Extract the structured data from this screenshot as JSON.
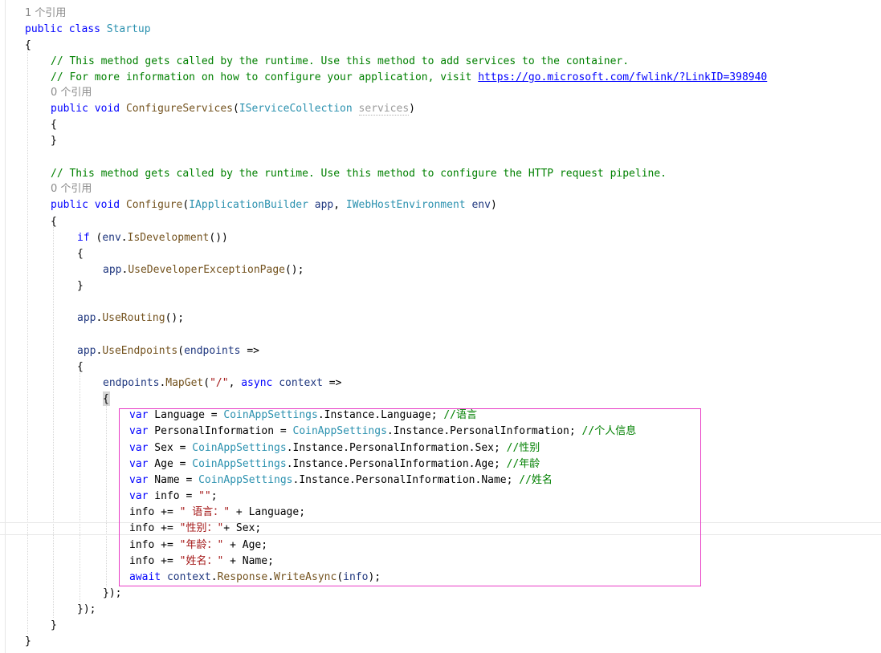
{
  "editor": {
    "lines": [
      [
        {
          "t": "1 个引用",
          "c": "lens"
        }
      ],
      [
        {
          "t": "public",
          "c": "kw"
        },
        {
          "t": " "
        },
        {
          "t": "class",
          "c": "kw"
        },
        {
          "t": " "
        },
        {
          "t": "Startup",
          "c": "ty"
        }
      ],
      [
        {
          "t": "{"
        }
      ],
      [
        {
          "t": "// This method gets called by the runtime. Use this method to add services to the container.",
          "c": "cm"
        }
      ],
      [
        {
          "t": "// For more information on how to configure your application, visit ",
          "c": "cm"
        },
        {
          "t": "https://go.microsoft.com/fwlink/?LinkID=398940",
          "c": "link"
        }
      ],
      [
        {
          "t": "0 个引用",
          "c": "lens"
        }
      ],
      [
        {
          "t": "public",
          "c": "kw"
        },
        {
          "t": " "
        },
        {
          "t": "void",
          "c": "kw"
        },
        {
          "t": " "
        },
        {
          "t": "ConfigureServices",
          "c": "mt"
        },
        {
          "t": "("
        },
        {
          "t": "IServiceCollection",
          "c": "ty"
        },
        {
          "t": " "
        },
        {
          "t": "services",
          "c": "unused"
        },
        {
          "t": ")"
        }
      ],
      [
        {
          "t": "{"
        }
      ],
      [
        {
          "t": "}"
        }
      ],
      [
        {
          "t": "// This method gets called by the runtime. Use this method to configure the HTTP request pipeline.",
          "c": "cm"
        }
      ],
      [
        {
          "t": "0 个引用",
          "c": "lens"
        }
      ],
      [
        {
          "t": "public",
          "c": "kw"
        },
        {
          "t": " "
        },
        {
          "t": "void",
          "c": "kw"
        },
        {
          "t": " "
        },
        {
          "t": "Configure",
          "c": "mt"
        },
        {
          "t": "("
        },
        {
          "t": "IApplicationBuilder",
          "c": "ty"
        },
        {
          "t": " "
        },
        {
          "t": "app",
          "c": "pm"
        },
        {
          "t": ", "
        },
        {
          "t": "IWebHostEnvironment",
          "c": "ty"
        },
        {
          "t": " "
        },
        {
          "t": "env",
          "c": "pm"
        },
        {
          "t": ")"
        }
      ],
      [
        {
          "t": "{"
        }
      ],
      [
        {
          "t": "if",
          "c": "kw"
        },
        {
          "t": " ("
        },
        {
          "t": "env",
          "c": "pm"
        },
        {
          "t": "."
        },
        {
          "t": "IsDevelopment",
          "c": "mt"
        },
        {
          "t": "())"
        }
      ],
      [
        {
          "t": "{"
        }
      ],
      [
        {
          "t": "app",
          "c": "pm"
        },
        {
          "t": "."
        },
        {
          "t": "UseDeveloperExceptionPage",
          "c": "mt"
        },
        {
          "t": "();"
        }
      ],
      [
        {
          "t": "}"
        }
      ],
      [
        {
          "t": "app",
          "c": "pm"
        },
        {
          "t": "."
        },
        {
          "t": "UseRouting",
          "c": "mt"
        },
        {
          "t": "();"
        }
      ],
      [
        {
          "t": "app",
          "c": "pm"
        },
        {
          "t": "."
        },
        {
          "t": "UseEndpoints",
          "c": "mt"
        },
        {
          "t": "("
        },
        {
          "t": "endpoints",
          "c": "pm"
        },
        {
          "t": " =>"
        }
      ],
      [
        {
          "t": "{"
        }
      ],
      [
        {
          "t": "endpoints",
          "c": "pm"
        },
        {
          "t": "."
        },
        {
          "t": "MapGet",
          "c": "mt"
        },
        {
          "t": "("
        },
        {
          "t": "\"/\"",
          "c": "st"
        },
        {
          "t": ", "
        },
        {
          "t": "async",
          "c": "kw"
        },
        {
          "t": " "
        },
        {
          "t": "context",
          "c": "pm"
        },
        {
          "t": " =>"
        }
      ],
      [
        {
          "t": "{"
        }
      ],
      [
        {
          "t": "var",
          "c": "kw"
        },
        {
          "t": " Language = "
        },
        {
          "t": "CoinAppSettings",
          "c": "ty"
        },
        {
          "t": ".Instance.Language; "
        },
        {
          "t": "//语言",
          "c": "cm"
        }
      ],
      [
        {
          "t": "var",
          "c": "kw"
        },
        {
          "t": " PersonalInformation = "
        },
        {
          "t": "CoinAppSettings",
          "c": "ty"
        },
        {
          "t": ".Instance.PersonalInformation; "
        },
        {
          "t": "//个人信息",
          "c": "cm"
        }
      ],
      [
        {
          "t": "var",
          "c": "kw"
        },
        {
          "t": " Sex = "
        },
        {
          "t": "CoinAppSettings",
          "c": "ty"
        },
        {
          "t": ".Instance.PersonalInformation.Sex; "
        },
        {
          "t": "//性别",
          "c": "cm"
        }
      ],
      [
        {
          "t": "var",
          "c": "kw"
        },
        {
          "t": " Age = "
        },
        {
          "t": "CoinAppSettings",
          "c": "ty"
        },
        {
          "t": ".Instance.PersonalInformation.Age; "
        },
        {
          "t": "//年龄",
          "c": "cm"
        }
      ],
      [
        {
          "t": "var",
          "c": "kw"
        },
        {
          "t": " Name = "
        },
        {
          "t": "CoinAppSettings",
          "c": "ty"
        },
        {
          "t": ".Instance.PersonalInformation.Name; "
        },
        {
          "t": "//姓名",
          "c": "cm"
        }
      ],
      [
        {
          "t": "var",
          "c": "kw"
        },
        {
          "t": " info = "
        },
        {
          "t": "\"\"",
          "c": "st"
        },
        {
          "t": ";"
        }
      ],
      [
        {
          "t": "info += "
        },
        {
          "t": "\" 语言：\"",
          "c": "st"
        },
        {
          "t": " + Language;"
        }
      ],
      [
        {
          "t": "info += "
        },
        {
          "t": "\"性别：\"",
          "c": "st"
        },
        {
          "t": "+ Sex;"
        }
      ],
      [
        {
          "t": "info += "
        },
        {
          "t": "\"年龄：\"",
          "c": "st"
        },
        {
          "t": " + Age;"
        }
      ],
      [
        {
          "t": "info += "
        },
        {
          "t": "\"姓名：\"",
          "c": "st"
        },
        {
          "t": " + Name;"
        }
      ],
      [
        {
          "t": "await",
          "c": "kw"
        },
        {
          "t": " "
        },
        {
          "t": "context",
          "c": "pm"
        },
        {
          "t": "."
        },
        {
          "t": "Response",
          "c": "mt"
        },
        {
          "t": "."
        },
        {
          "t": "WriteAsync",
          "c": "mt"
        },
        {
          "t": "("
        },
        {
          "t": "info",
          "c": "pm"
        },
        {
          "t": ");"
        }
      ],
      [
        {
          "t": "});"
        }
      ],
      [
        {
          "t": "});"
        }
      ],
      [
        {
          "t": "}"
        }
      ],
      [
        {
          "t": "}"
        }
      ]
    ]
  },
  "colors": {
    "keyword": "#0000ff",
    "type": "#2b91af",
    "comment": "#008000",
    "string": "#a31515",
    "method": "#74531f",
    "codelens": "#8a8a8a",
    "selection_box": "#e83cc6"
  }
}
